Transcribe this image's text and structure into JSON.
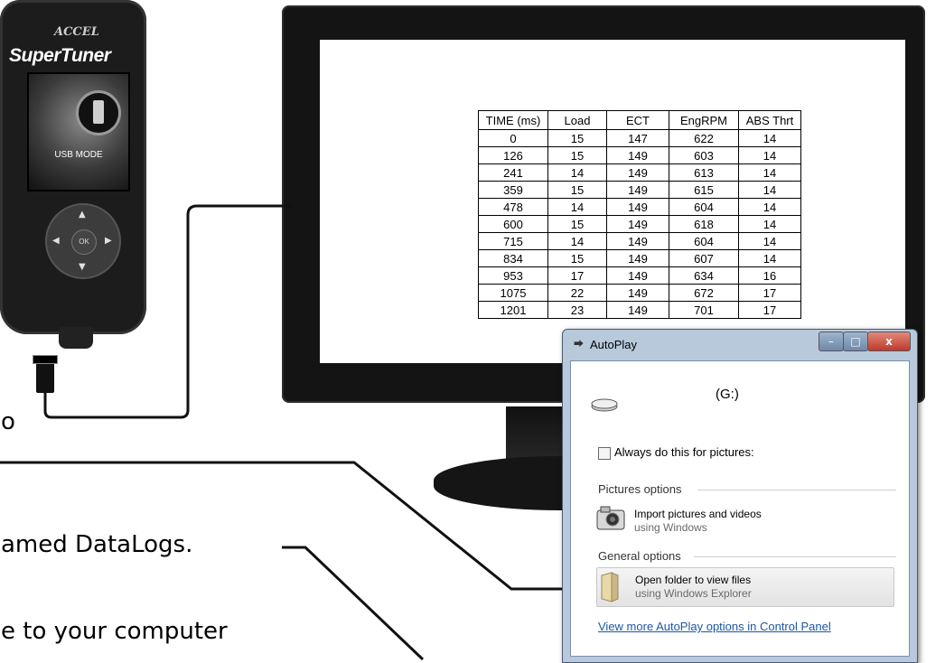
{
  "device": {
    "brand": "ACCEL",
    "model": "SuperTuner",
    "screen_text": "USB MODE",
    "ok_label": "OK"
  },
  "table": {
    "headers": [
      "TIME (ms)",
      "Load",
      "ECT",
      "EngRPM",
      "ABS Thrt"
    ],
    "rows": [
      [
        "0",
        "15",
        "147",
        "622",
        "14"
      ],
      [
        "126",
        "15",
        "149",
        "603",
        "14"
      ],
      [
        "241",
        "14",
        "149",
        "613",
        "14"
      ],
      [
        "359",
        "15",
        "149",
        "615",
        "14"
      ],
      [
        "478",
        "14",
        "149",
        "604",
        "14"
      ],
      [
        "600",
        "15",
        "149",
        "618",
        "14"
      ],
      [
        "715",
        "14",
        "149",
        "604",
        "14"
      ],
      [
        "834",
        "15",
        "149",
        "607",
        "14"
      ],
      [
        "953",
        "17",
        "149",
        "634",
        "16"
      ],
      [
        "1075",
        "22",
        "149",
        "672",
        "17"
      ],
      [
        "1201",
        "23",
        "149",
        "701",
        "17"
      ]
    ]
  },
  "autoplay": {
    "title": "AutoPlay",
    "minimize_label": "–",
    "maximize_label": "□",
    "close_label": "x",
    "drive_label": "(G:)",
    "always_checkbox_label": "Always do this for pictures:",
    "always_checked": false,
    "pictures_section": "Pictures options",
    "import_title": "Import pictures and videos",
    "import_sub": "using Windows",
    "general_section": "General options",
    "open_title": "Open folder to view files",
    "open_sub": "using Windows Explorer",
    "more_link": "View more AutoPlay options in Control Panel"
  },
  "manual_text": {
    "line1": "o",
    "line2": "amed DataLogs.",
    "line3": "e to your computer"
  },
  "colors": {
    "link": "#1b57a5",
    "close_button": "#c0392b",
    "dialog_frame": "#b8c9dc"
  }
}
